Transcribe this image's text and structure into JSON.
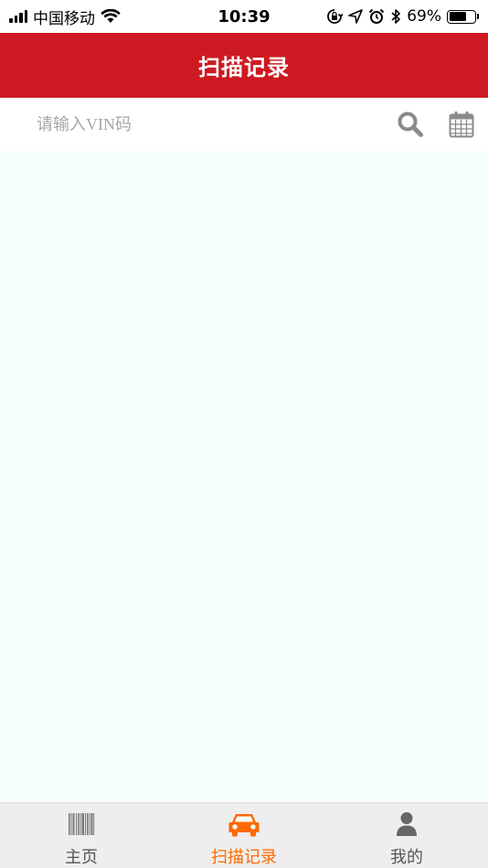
{
  "status_bar": {
    "carrier": "中国移动",
    "time": "10:39",
    "battery_percent": "69%",
    "battery_level": 0.69
  },
  "header": {
    "title": "扫描记录"
  },
  "search": {
    "placeholder": "请输入VIN码",
    "value": ""
  },
  "tabs": [
    {
      "label": "主页",
      "icon": "barcode-icon",
      "active": false
    },
    {
      "label": "扫描记录",
      "icon": "car-icon",
      "active": true
    },
    {
      "label": "我的",
      "icon": "user-icon",
      "active": false
    }
  ],
  "colors": {
    "header_bg": "#cd1a22",
    "active_tab": "#ff6a00",
    "icon_gray": "#8a8a8a",
    "content_bg": "#f7fefe"
  }
}
